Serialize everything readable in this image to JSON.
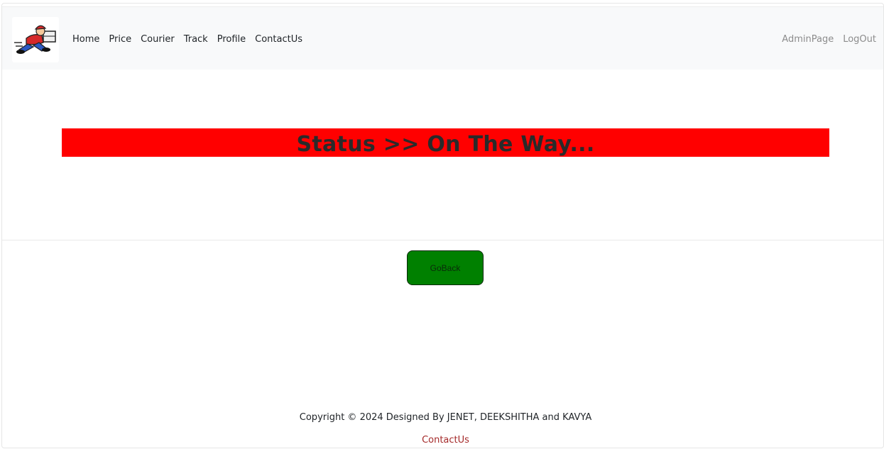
{
  "navbar": {
    "logo_icon": "courier-delivery-man-logo",
    "left_links": [
      "Home",
      "Price",
      "Courier",
      "Track",
      "Profile",
      "ContactUs"
    ],
    "right_links": [
      "AdminPage",
      "LogOut"
    ]
  },
  "main": {
    "status_text": "Status >> On The Way...",
    "status_color": "#ff0000",
    "goback_label": "GoBack",
    "goback_color": "#008000"
  },
  "footer": {
    "copyright": "Copyright © 2024 Designed By JENET, DEEKSHITHA and KAVYA",
    "contact_label": "ContactUs",
    "contact_color": "#a52a2a"
  }
}
